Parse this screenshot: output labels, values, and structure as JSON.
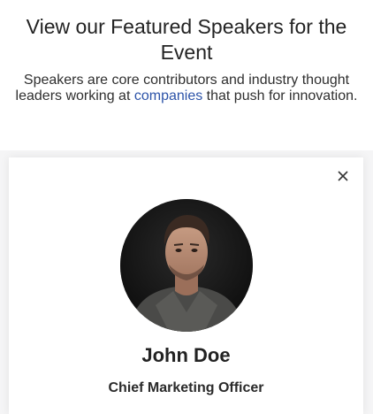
{
  "header": {
    "title": "View our Featured Speakers for the Event",
    "subtitle_before": "Speakers are core contributors and industry thought leaders working at ",
    "subtitle_link": "companies",
    "subtitle_after": " that push for innovation."
  },
  "modal": {
    "close_icon": "close-icon",
    "speaker": {
      "name": "John Doe",
      "role": "Chief Marketing Officer"
    }
  },
  "colors": {
    "link": "#2c53a8",
    "text": "#232323"
  }
}
